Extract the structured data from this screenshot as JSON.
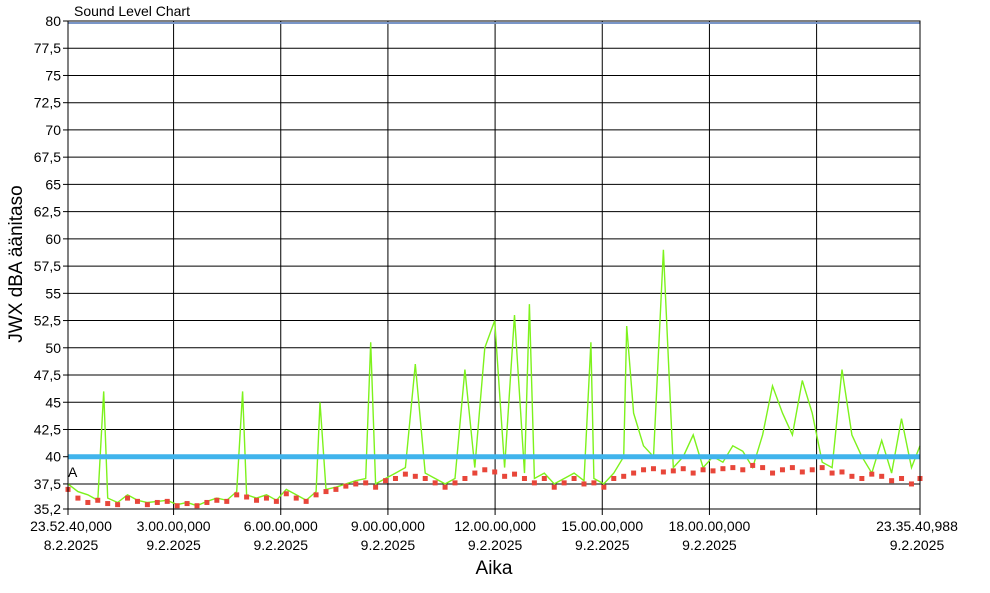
{
  "chart_data": {
    "type": "line",
    "title": "Sound Level Chart",
    "xlabel": "Aika",
    "ylabel": "JWX dBA äänitaso",
    "ylim": [
      35.2,
      80
    ],
    "xlim": [
      0,
      85860
    ],
    "y_ticks": [
      "80",
      "77,5",
      "75",
      "72,5",
      "70",
      "67,5",
      "65",
      "62,5",
      "60",
      "57,5",
      "55",
      "52,5",
      "50",
      "47,5",
      "45",
      "42,5",
      "40",
      "37,5",
      "35,2"
    ],
    "x_ticks": [
      {
        "t": 0,
        "line1": "23.52.40,000",
        "line2": "8.2.2025"
      },
      {
        "t": 10640,
        "line1": "3.00.00,000",
        "line2": "9.2.2025"
      },
      {
        "t": 21440,
        "line1": "6.00.00,000",
        "line2": "9.2.2025"
      },
      {
        "t": 32240,
        "line1": "9.00.00,000",
        "line2": "9.2.2025"
      },
      {
        "t": 43040,
        "line1": "12.00.00,000",
        "line2": "9.2.2025"
      },
      {
        "t": 53840,
        "line1": "15.00.00,000",
        "line2": "9.2.2025"
      },
      {
        "t": 64640,
        "line1": "18.00.00,000",
        "line2": "9.2.2025"
      },
      {
        "t": 85860,
        "line1": "23.35.40,988",
        "line2": "9.2.2025"
      }
    ],
    "extra_gridline_t": [
      75440
    ],
    "grid": true,
    "threshold": {
      "value": 40,
      "color": "#40b4ec"
    },
    "marker_label": "A",
    "series": [
      {
        "style": "line",
        "color": "#7df21c",
        "x": [
          0,
          1000,
          2000,
          3000,
          3600,
          4000,
          5000,
          6000,
          7000,
          8000,
          9000,
          10000,
          11000,
          12000,
          13000,
          14000,
          15000,
          16000,
          17000,
          17600,
          18000,
          19000,
          20000,
          21000,
          22000,
          23000,
          24000,
          25000,
          25400,
          26000,
          27000,
          28000,
          29000,
          30000,
          30500,
          31000,
          32000,
          33000,
          34000,
          35000,
          36000,
          37000,
          38000,
          39000,
          40000,
          41000,
          42000,
          43000,
          44000,
          45000,
          46000,
          46500,
          47000,
          48000,
          49000,
          50000,
          51000,
          52000,
          52700,
          53000,
          54000,
          55000,
          56000,
          56300,
          57000,
          58000,
          59000,
          60000,
          61000,
          62000,
          63000,
          64000,
          65000,
          66000,
          67000,
          68000,
          69000,
          70000,
          71000,
          72000,
          73000,
          74000,
          75000,
          76000,
          77000,
          78000,
          79000,
          80000,
          81000,
          82000,
          83000,
          84000,
          85000,
          85860
        ],
        "y": [
          37.5,
          36.8,
          36.5,
          36.0,
          46.0,
          36.2,
          35.8,
          36.5,
          36.0,
          35.8,
          35.9,
          36.0,
          35.6,
          35.8,
          35.5,
          35.9,
          36.2,
          36.0,
          36.8,
          46.0,
          36.5,
          36.2,
          36.5,
          36.0,
          37.0,
          36.5,
          36.0,
          36.8,
          45.0,
          37.0,
          37.2,
          37.5,
          37.8,
          38.0,
          50.5,
          37.5,
          38.0,
          38.5,
          39.0,
          48.5,
          38.5,
          38.0,
          37.5,
          38.0,
          48.0,
          39.0,
          50.0,
          52.5,
          39.0,
          53.0,
          38.5,
          54.0,
          38.0,
          38.5,
          37.5,
          38.0,
          38.5,
          37.8,
          50.5,
          38.0,
          37.5,
          38.5,
          40.0,
          52.0,
          44.0,
          41.0,
          40.0,
          59.0,
          39.0,
          40.0,
          42.0,
          39.0,
          40.0,
          39.5,
          41.0,
          40.5,
          39.0,
          42.0,
          46.5,
          44.0,
          42.0,
          47.0,
          44.0,
          39.5,
          39.0,
          48.0,
          42.0,
          40.0,
          38.5,
          41.5,
          38.5,
          43.5,
          39.0,
          41.0
        ]
      },
      {
        "style": "markers",
        "color": "#e8463a",
        "x": [
          0,
          1000,
          2000,
          3000,
          4000,
          5000,
          6000,
          7000,
          8000,
          9000,
          10000,
          11000,
          12000,
          13000,
          14000,
          15000,
          16000,
          17000,
          18000,
          19000,
          20000,
          21000,
          22000,
          23000,
          24000,
          25000,
          26000,
          27000,
          28000,
          29000,
          30000,
          31000,
          32000,
          33000,
          34000,
          35000,
          36000,
          37000,
          38000,
          39000,
          40000,
          41000,
          42000,
          43000,
          44000,
          45000,
          46000,
          47000,
          48000,
          49000,
          50000,
          51000,
          52000,
          53000,
          54000,
          55000,
          56000,
          57000,
          58000,
          59000,
          60000,
          61000,
          62000,
          63000,
          64000,
          65000,
          66000,
          67000,
          68000,
          69000,
          70000,
          71000,
          72000,
          73000,
          74000,
          75000,
          76000,
          77000,
          78000,
          79000,
          80000,
          81000,
          82000,
          83000,
          84000,
          85000,
          85860
        ],
        "y": [
          37.0,
          36.2,
          35.8,
          36.0,
          35.7,
          35.6,
          36.2,
          35.9,
          35.6,
          35.8,
          35.9,
          35.5,
          35.7,
          35.5,
          35.8,
          36.0,
          35.9,
          36.5,
          36.3,
          36.0,
          36.2,
          35.9,
          36.6,
          36.2,
          35.9,
          36.5,
          36.8,
          37.0,
          37.3,
          37.5,
          37.6,
          37.2,
          37.8,
          38.0,
          38.4,
          38.2,
          38.0,
          37.6,
          37.2,
          37.6,
          38.0,
          38.5,
          38.8,
          38.6,
          38.2,
          38.4,
          38.0,
          37.6,
          38.0,
          37.2,
          37.6,
          38.0,
          37.5,
          37.6,
          37.2,
          38.0,
          38.2,
          38.5,
          38.8,
          38.9,
          38.6,
          38.7,
          38.9,
          38.5,
          38.8,
          38.7,
          38.9,
          39.0,
          38.8,
          39.2,
          39.0,
          38.5,
          38.8,
          39.0,
          38.6,
          38.8,
          39.0,
          38.5,
          38.6,
          38.2,
          38.0,
          38.4,
          38.2,
          37.8,
          38.0,
          37.5,
          38.0
        ]
      }
    ]
  }
}
